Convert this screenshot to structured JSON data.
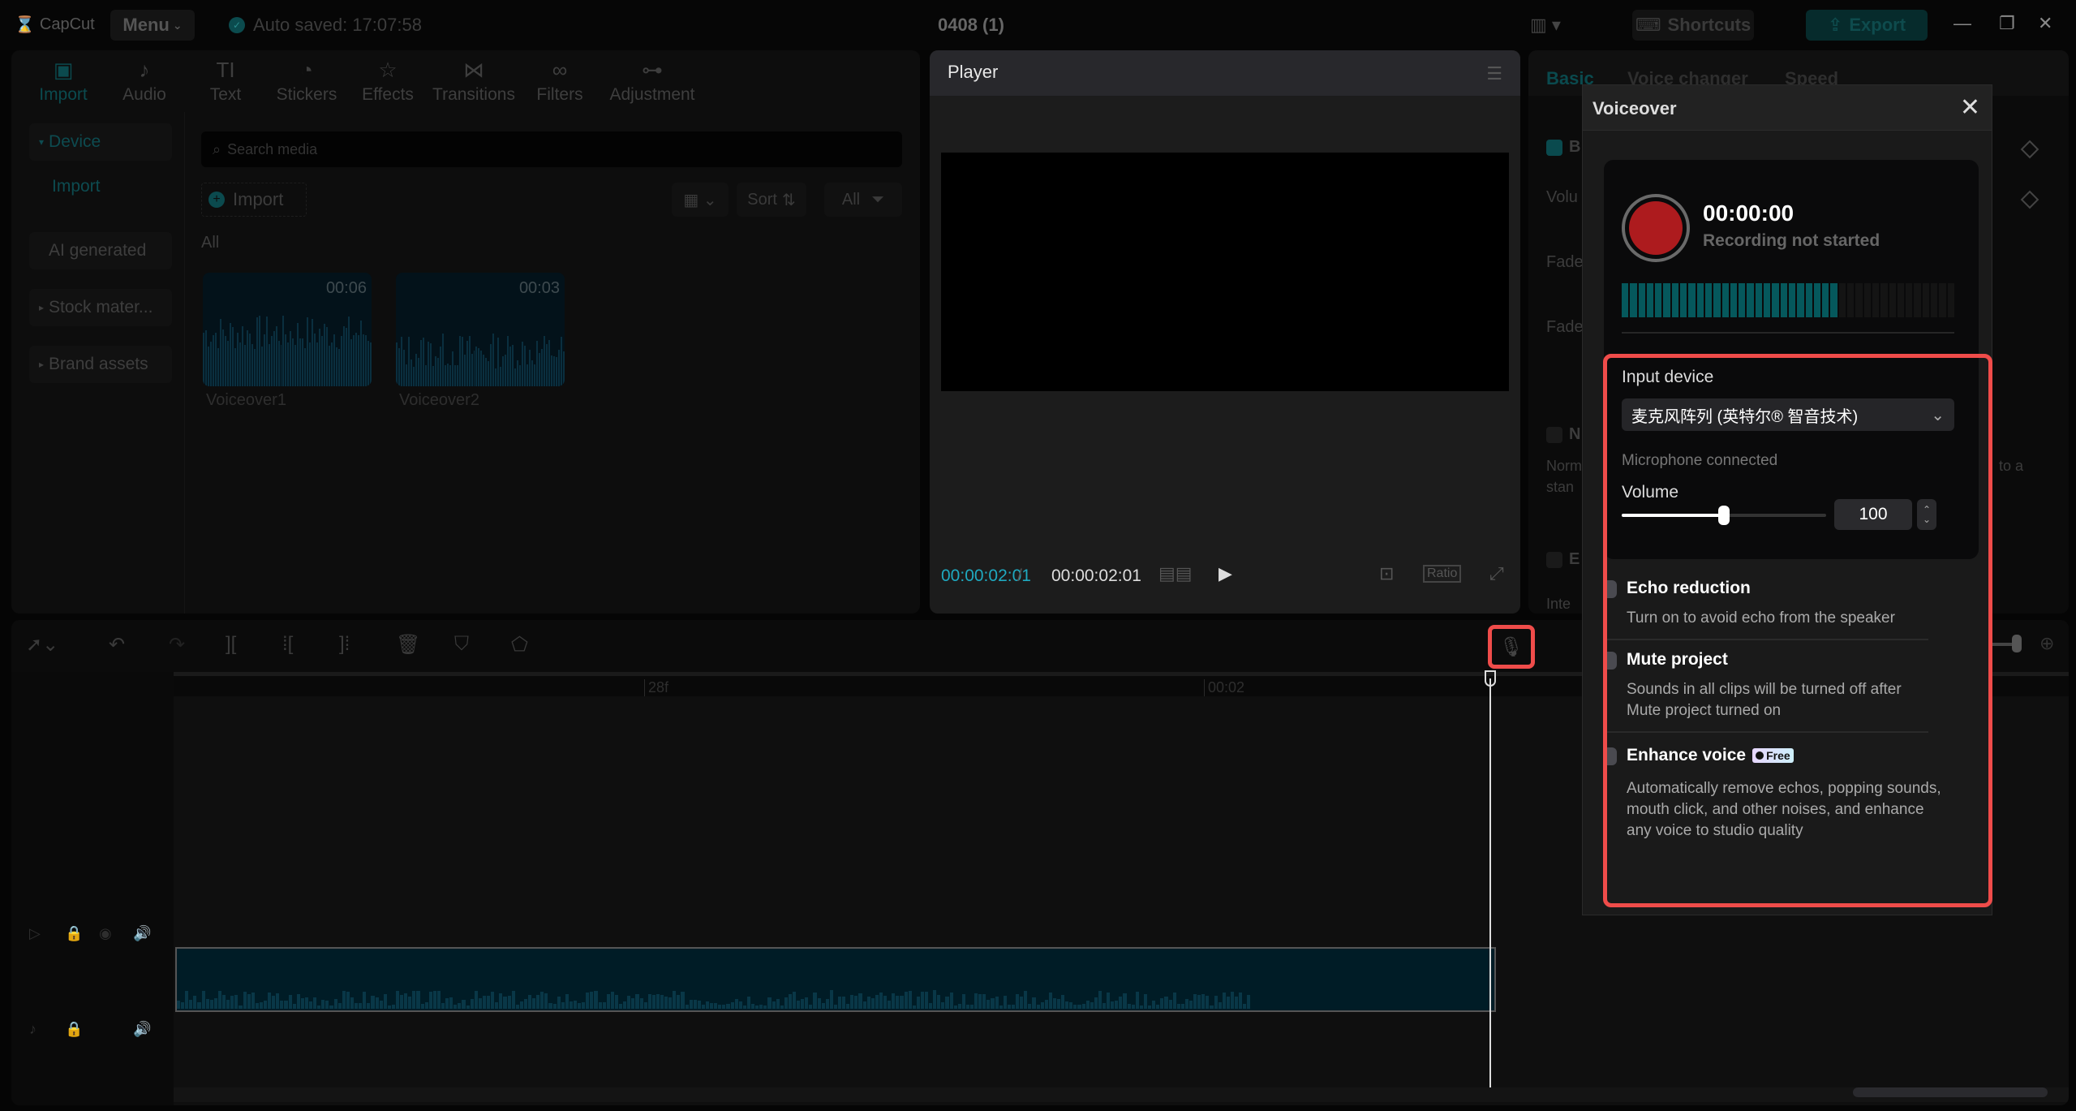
{
  "titlebar": {
    "app_name": "CapCut",
    "menu_label": "Menu",
    "autosave_text": "Auto saved: 17:07:58",
    "project_title": "0408 (1)",
    "shortcuts_label": "Shortcuts",
    "export_label": "Export"
  },
  "media": {
    "tools": [
      {
        "label": "Import",
        "icon": "import-icon"
      },
      {
        "label": "Audio",
        "icon": "audio-icon"
      },
      {
        "label": "Text",
        "icon": "text-icon"
      },
      {
        "label": "Stickers",
        "icon": "sticker-icon"
      },
      {
        "label": "Effects",
        "icon": "effects-icon"
      },
      {
        "label": "Transitions",
        "icon": "transitions-icon"
      },
      {
        "label": "Filters",
        "icon": "filters-icon"
      },
      {
        "label": "Adjustment",
        "icon": "adjustment-icon"
      }
    ],
    "sidebar": {
      "device": "Device",
      "import": "Import",
      "ai_generated": "AI generated",
      "stock": "Stock mater...",
      "brand": "Brand assets"
    },
    "search_placeholder": "Search media",
    "import_label": "Import",
    "sort_label": "Sort",
    "filter_label": "All",
    "section_label": "All",
    "items": [
      {
        "name": "Voiceover1",
        "duration": "00:06"
      },
      {
        "name": "Voiceover2",
        "duration": "00:03"
      }
    ]
  },
  "player": {
    "title": "Player",
    "current_time": "00:00:02:01",
    "separator": "/",
    "total_time": "00:00:02:01",
    "ratio_label": "Ratio"
  },
  "props": {
    "tabs": [
      "Basic",
      "Voice changer",
      "Speed"
    ],
    "fragments": {
      "basic": "B",
      "volume": "Volu",
      "fade_in": "Fade",
      "fade_out": "Fade",
      "normalize": "N",
      "normalize_desc_1": "Norm",
      "normalize_desc_2": "stan",
      "normalize_desc_right": "to a",
      "enhance": "E",
      "enhance_desc": "Inte"
    }
  },
  "timeline": {
    "ruler": [
      "28f",
      "00:02"
    ]
  },
  "voiceover": {
    "title": "Voiceover",
    "time": "00:00:00",
    "status": "Recording not started",
    "meter_level": 0.64,
    "input_device_label": "Input device",
    "input_device_value": "麦克风阵列 (英特尔® 智音技术)",
    "mic_status": "Microphone connected",
    "volume_label": "Volume",
    "volume_value": "100",
    "volume_slider_fraction": 0.5,
    "options": [
      {
        "title": "Echo reduction",
        "desc": "Turn on to avoid echo from the speaker",
        "checked": false
      },
      {
        "title": "Mute project",
        "desc": "Sounds in all clips will be turned off after Mute project turned on",
        "checked": false
      },
      {
        "title": "Enhance voice",
        "badge": "Free",
        "desc": "Automatically remove echos, popping sounds, mouth click, and other noises, and enhance any voice to studio quality",
        "checked": false
      }
    ]
  },
  "colors": {
    "accent": "#1fa9c0",
    "record": "#ad1b1e",
    "highlight": "#ef4c4a"
  }
}
